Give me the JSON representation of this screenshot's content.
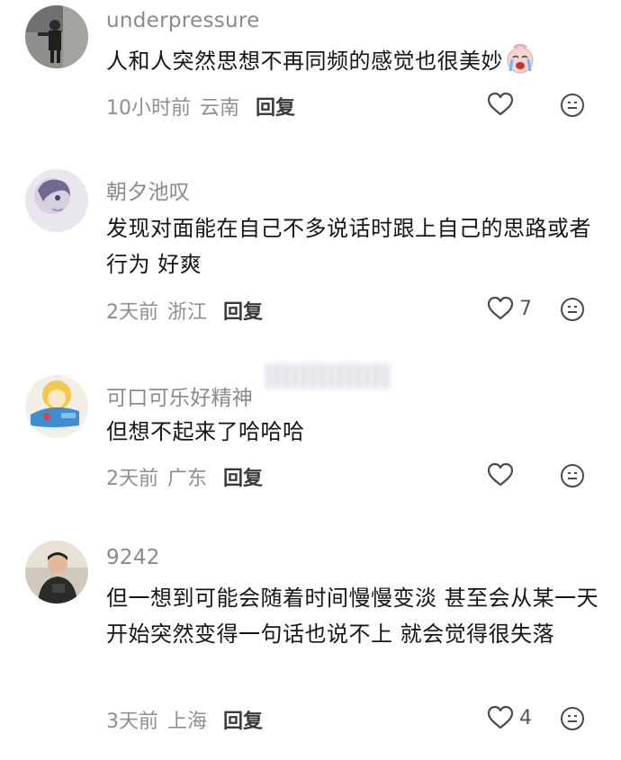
{
  "comments": [
    {
      "username": "underpressure",
      "text": "人和人突然思想不再同频的感觉也很美妙",
      "emoji": "crying-face-emoji",
      "time": "10小时前",
      "location": "云南",
      "reply_label": "回复",
      "likes": ""
    },
    {
      "username": "朝夕池叹",
      "text": "发现对面能在自己不多说话时跟上自己的思路或者行为 好爽",
      "time": "2天前",
      "location": "浙江",
      "reply_label": "回复",
      "likes": "7"
    },
    {
      "username": "可口可乐好精神",
      "text": "但想不起来了哈哈哈",
      "time": "2天前",
      "location": "广东",
      "reply_label": "回复",
      "likes": ""
    },
    {
      "username": "9242",
      "text": "但一想到可能会随着时间慢慢变淡 甚至会从某一天开始突然变得一句话也说不上 就会觉得很失落",
      "time": "3天前",
      "location": "上海",
      "reply_label": "回复",
      "likes": "4"
    }
  ],
  "colors": {
    "username": "#8a8a8a",
    "meta": "#8f8f8f",
    "text": "#161616",
    "icon": "#4a4a4a"
  },
  "icons": {
    "like": "heart-outline-icon",
    "dislike": "neutral-face-icon"
  }
}
